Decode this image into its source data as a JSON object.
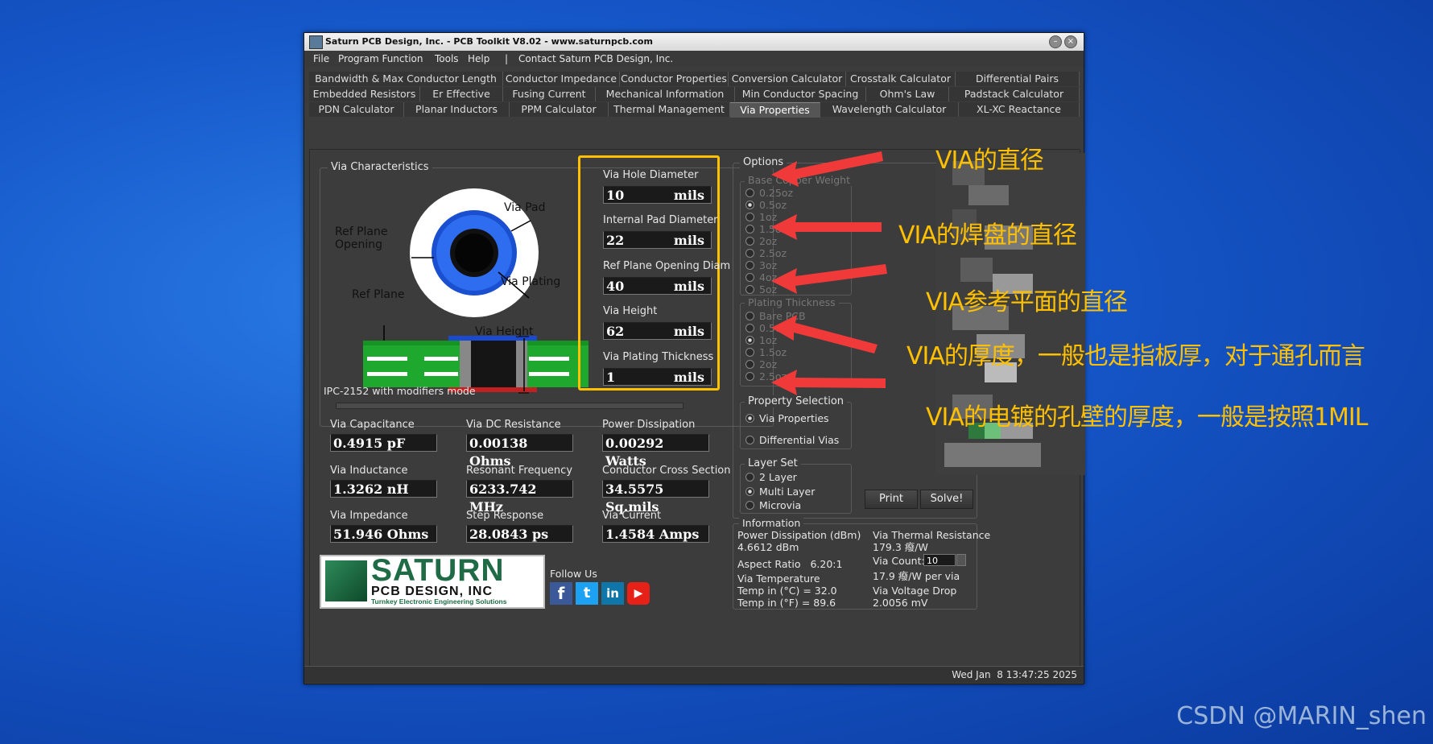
{
  "window": {
    "title": "Saturn PCB Design, Inc. - PCB Toolkit V8.02 - www.saturnpcb.com",
    "minimize": "–",
    "close": "×"
  },
  "menu": [
    "File",
    "Program Function",
    "Tools",
    "Help",
    "|",
    "Contact Saturn PCB Design, Inc."
  ],
  "tabs": {
    "row1": [
      "Bandwidth & Max Conductor Length",
      "Conductor Impedance",
      "Conductor Properties",
      "Conversion Calculator",
      "Crosstalk Calculator",
      "Differential Pairs"
    ],
    "row2": [
      "Embedded Resistors",
      "Er Effective",
      "Fusing Current",
      "Mechanical Information",
      "Min Conductor Spacing",
      "Ohm's Law",
      "Padstack Calculator"
    ],
    "row3": [
      "PDN Calculator",
      "Planar Inductors",
      "PPM Calculator",
      "Thermal Management",
      "Via Properties",
      "Wavelength Calculator",
      "XL-XC Reactance"
    ],
    "active": "Via Properties"
  },
  "via_characteristics": {
    "group_label": "Via Characteristics",
    "diagram_labels": {
      "via_pad": "Via Pad",
      "ref_plane_opening": "Ref Plane\nOpening",
      "via_plating": "Via Plating",
      "ref_plane": "Ref Plane",
      "via_height": "Via Height"
    },
    "mode_text": "IPC-2152 with modifiers mode"
  },
  "inputs": [
    {
      "label": "Via Hole Diameter",
      "value": "10",
      "unit": "mils"
    },
    {
      "label": "Internal Pad Diameter",
      "value": "22",
      "unit": "mils"
    },
    {
      "label": "Ref Plane Opening Diam",
      "value": "40",
      "unit": "mils"
    },
    {
      "label": "Via Height",
      "value": "62",
      "unit": "mils"
    },
    {
      "label": "Via Plating Thickness",
      "value": "1",
      "unit": "mils"
    }
  ],
  "results": [
    {
      "label": "Via Capacitance",
      "value": "0.4915 pF"
    },
    {
      "label": "Via DC Resistance",
      "value": "0.00138 Ohms"
    },
    {
      "label": "Power Dissipation",
      "value": "0.00292 Watts"
    },
    {
      "label": "Via Inductance",
      "value": "1.3262 nH"
    },
    {
      "label": "Resonant Frequency",
      "value": "6233.742 MHz"
    },
    {
      "label": "Conductor Cross Section",
      "value": "34.5575 Sq.mils"
    },
    {
      "label": "Via Impedance",
      "value": "51.946 Ohms"
    },
    {
      "label": "Step Response",
      "value": "28.0843 ps"
    },
    {
      "label": "Via Current",
      "value": "1.4584 Amps"
    }
  ],
  "options": {
    "group_label": "Options",
    "base_copper_label": "Base Copper Weight",
    "base_copper": [
      "0.25oz",
      "0.5oz",
      "1oz",
      "1.5oz",
      "2oz",
      "2.5oz",
      "3oz",
      "4oz",
      "5oz"
    ],
    "plating_label": "Plating Thickness",
    "plating": [
      "Bare PCB",
      "0.5oz",
      "1oz",
      "1.5oz",
      "2oz",
      "2.5oz"
    ],
    "property_label": "Property Selection",
    "property": [
      "Via Properties",
      "Differential Vias"
    ],
    "layer_label": "Layer Set",
    "layers": [
      "2 Layer",
      "Multi Layer",
      "Microvia"
    ],
    "print": "Print",
    "solve": "Solve!"
  },
  "information": {
    "group_label": "Information",
    "power_dbm_label": "Power Dissipation (dBm)",
    "power_dbm": "4.6612 dBm",
    "aspect_ratio": "Aspect Ratio   6.20:1",
    "via_temp_label": "Via Temperature",
    "temp_c": "Temp in (°C) = 32.0",
    "temp_f": "Temp in (°F) = 89.6",
    "thermal_res_label": "Via Thermal Resistance",
    "thermal_res": "179.3 癈/W",
    "via_count_label": "Via Count:",
    "via_count": "10",
    "per_via": "17.9 癈/W per via",
    "voltage_drop_label": "Via Voltage Drop",
    "voltage_drop": "2.0056 mV"
  },
  "logo": {
    "line1": "SATURN",
    "line2": "PCB DESIGN, INC",
    "line3": "Turnkey Electronic Engineering Solutions"
  },
  "follow_us": "Follow Us",
  "social": [
    "f",
    "t",
    "in",
    "▶"
  ],
  "status_time": "Wed Jan  8 13:47:25 2025",
  "annotations": [
    "VIA的直径",
    "VIA的焊盘的直径",
    "VIA参考平面的直径",
    "VIA的厚度，一般也是指板厚，对于通孔而言",
    "VIA的电镀的孔壁的厚度，一般是按照1MIL"
  ],
  "watermark": "CSDN @MARIN_shen",
  "colors": {
    "annotation": "#ffc000",
    "highlight_box": "#ffc000",
    "arrow": "#f03a3a",
    "logo_green": "#1f6b45"
  }
}
